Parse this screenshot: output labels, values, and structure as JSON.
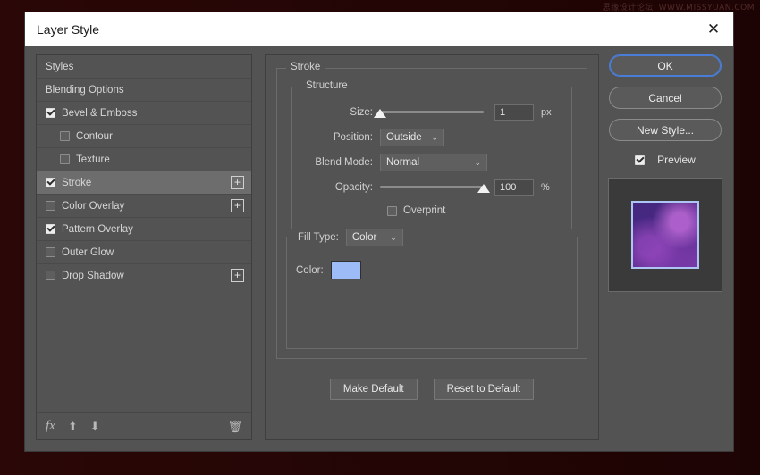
{
  "watermark": {
    "cn": "思缘设计论坛",
    "url": "WWW.MISSYUAN.COM"
  },
  "window": {
    "title": "Layer Style",
    "close_icon": "close-icon",
    "close_glyph": "✕"
  },
  "styles_panel": {
    "items": [
      {
        "label": "Styles",
        "checkbox": null,
        "sub": false,
        "selected": false,
        "plus": false
      },
      {
        "label": "Blending Options",
        "checkbox": null,
        "sub": false,
        "selected": false,
        "plus": false
      },
      {
        "label": "Bevel & Emboss",
        "checkbox": true,
        "sub": false,
        "selected": false,
        "plus": false
      },
      {
        "label": "Contour",
        "checkbox": false,
        "sub": true,
        "selected": false,
        "plus": false
      },
      {
        "label": "Texture",
        "checkbox": false,
        "sub": true,
        "selected": false,
        "plus": false
      },
      {
        "label": "Stroke",
        "checkbox": true,
        "sub": false,
        "selected": true,
        "plus": true
      },
      {
        "label": "Color Overlay",
        "checkbox": false,
        "sub": false,
        "selected": false,
        "plus": true
      },
      {
        "label": "Pattern Overlay",
        "checkbox": true,
        "sub": false,
        "selected": false,
        "plus": false
      },
      {
        "label": "Outer Glow",
        "checkbox": false,
        "sub": false,
        "selected": false,
        "plus": false
      },
      {
        "label": "Drop Shadow",
        "checkbox": false,
        "sub": false,
        "selected": false,
        "plus": true
      }
    ],
    "plus_glyph": "+",
    "toolbar": {
      "fx_label": "fx",
      "fx_caret": "▾",
      "move_up_glyph": "⬆",
      "move_down_glyph": "⬇",
      "delete_glyph": "🗑"
    }
  },
  "stroke": {
    "group_title": "Stroke",
    "structure_title": "Structure",
    "size": {
      "label": "Size:",
      "value": "1",
      "unit": "px",
      "percent": 0
    },
    "position": {
      "label": "Position:",
      "value": "Outside"
    },
    "blend_mode": {
      "label": "Blend Mode:",
      "value": "Normal"
    },
    "opacity": {
      "label": "Opacity:",
      "value": "100",
      "unit": "%",
      "percent": 100
    },
    "overprint": {
      "label": "Overprint",
      "checked": false
    },
    "fill_type": {
      "label": "Fill Type:",
      "value": "Color"
    },
    "color": {
      "label": "Color:",
      "hex": "#9dbcf7"
    },
    "caret_glyph": "⌄"
  },
  "center_buttons": {
    "make_default": "Make Default",
    "reset_to_default": "Reset to Default"
  },
  "right_panel": {
    "ok": "OK",
    "cancel": "Cancel",
    "new_style": "New Style...",
    "preview": {
      "label": "Preview",
      "checked": true
    }
  }
}
